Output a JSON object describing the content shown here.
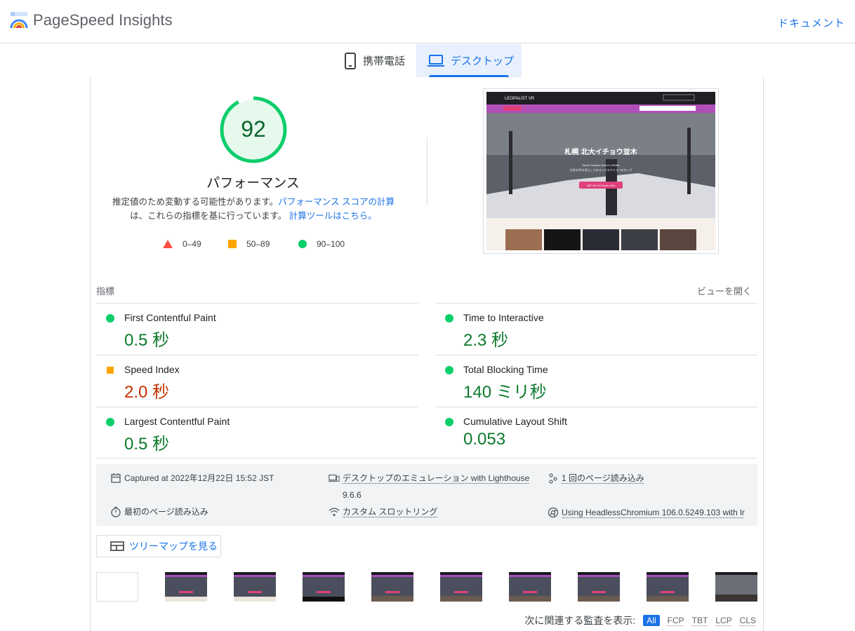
{
  "header": {
    "app_title": "PageSpeed Insights",
    "docs_link": "ドキュメント"
  },
  "tabs": [
    {
      "label": "携帯電話",
      "icon": "smartphone-icon",
      "selected": false
    },
    {
      "label": "デスクトップ",
      "icon": "laptop-icon",
      "selected": true
    }
  ],
  "score": {
    "value": "92",
    "fraction": 0.92,
    "title": "パフォーマンス",
    "desc_part1": "推定値のため変動する可能性があります。",
    "desc_link1": "パフォーマンス スコアの計算",
    "desc_part2": "は、これらの指標を基に行っています。",
    "desc_link2": "計算ツールはこちら。",
    "legend": {
      "fail": "0–49",
      "average": "50–89",
      "pass": "90–100"
    }
  },
  "screenshot": {
    "site_name": "LEOPALIST VR",
    "hero_title": "札幌 北大イチョウ並木",
    "hero_subtitle": "Snow Campus Scene | Winter",
    "hero_caption": "大学の10大学としてのコンバスアイコンをタップ",
    "hero_button": "360° VR Full Screen View"
  },
  "metrics": {
    "label": "指標",
    "expand": "ビューを開く",
    "items": [
      {
        "name": "First Contentful Paint",
        "value": "0.5 秒",
        "status": "pass"
      },
      {
        "name": "Time to Interactive",
        "value": "2.3 秒",
        "status": "pass"
      },
      {
        "name": "Speed Index",
        "value": "2.0 秒",
        "status": "average"
      },
      {
        "name": "Total Blocking Time",
        "value": "140 ミリ秒",
        "status": "pass"
      },
      {
        "name": "Largest Contentful Paint",
        "value": "0.5 秒",
        "status": "pass"
      },
      {
        "name": "Cumulative Layout Shift",
        "value": "0.053",
        "status": "pass"
      }
    ]
  },
  "runtime": {
    "captured": "Captured at 2022年12月22日 15:52 JST",
    "emulation": "デスクトップのエミュレーション with Lighthouse",
    "lighthouse_version": "9.6.6",
    "page_loads": "1 回のページ読み込み",
    "initial_load": "最初のページ読み込み",
    "throttling": "カスタム スロットリング",
    "browser": "Using HeadlessChromium 106.0.5249.103 with lr"
  },
  "treemap_button": "ツリーマップを見る",
  "filter": {
    "label": "次に関連する監査を表示:",
    "chips": [
      "All",
      "FCP",
      "TBT",
      "LCP",
      "CLS"
    ]
  },
  "colors": {
    "pass": "#0cce6b",
    "average": "#ffa400",
    "fail": "#ff4e42",
    "link": "#1a73e8"
  }
}
